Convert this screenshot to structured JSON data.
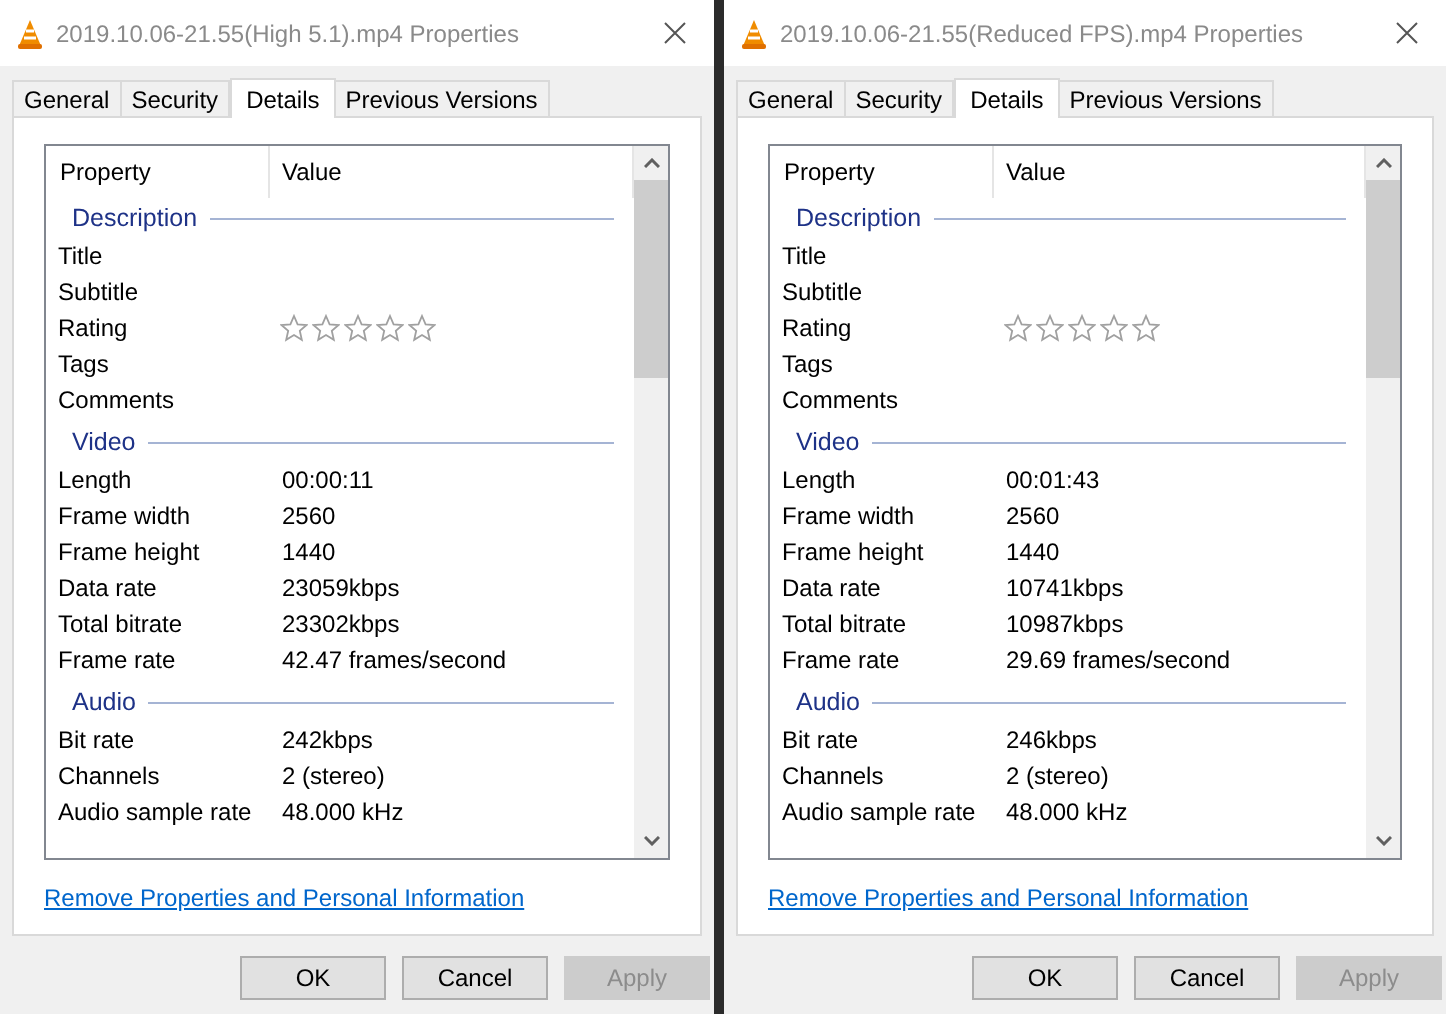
{
  "dialogs": [
    {
      "title": "2019.10.06-21.55(High 5.1).mp4 Properties",
      "active": false,
      "tabs": [
        {
          "label": "General",
          "selected": false
        },
        {
          "label": "Security",
          "selected": false
        },
        {
          "label": "Details",
          "selected": true
        },
        {
          "label": "Previous Versions",
          "selected": false
        }
      ],
      "columns": [
        "Property",
        "Value"
      ],
      "rows": [
        {
          "kind": "section",
          "label": "Description"
        },
        {
          "kind": "property",
          "label": "Title"
        },
        {
          "kind": "property",
          "label": "Subtitle"
        },
        {
          "kind": "rating",
          "label": "Rating",
          "stars": 0
        },
        {
          "kind": "property",
          "label": "Tags"
        },
        {
          "kind": "property",
          "label": "Comments"
        },
        {
          "kind": "section",
          "label": "Video"
        },
        {
          "kind": "property",
          "label": "Length",
          "value": "00:00:11"
        },
        {
          "kind": "property",
          "label": "Frame width",
          "value": "2560"
        },
        {
          "kind": "property",
          "label": "Frame height",
          "value": "1440"
        },
        {
          "kind": "property",
          "label": "Data rate",
          "value": "23059kbps"
        },
        {
          "kind": "property",
          "label": "Total bitrate",
          "value": "23302kbps"
        },
        {
          "kind": "property",
          "label": "Frame rate",
          "value": "42.47 frames/second"
        },
        {
          "kind": "section",
          "label": "Audio"
        },
        {
          "kind": "property",
          "label": "Bit rate",
          "value": "242kbps"
        },
        {
          "kind": "property",
          "label": "Channels",
          "value": "2 (stereo)"
        },
        {
          "kind": "property",
          "label": "Audio sample rate",
          "value": "48.000 kHz"
        }
      ],
      "link": "Remove Properties and Personal Information",
      "buttons": [
        {
          "label": "OK",
          "disabled": false
        },
        {
          "label": "Cancel",
          "disabled": false
        },
        {
          "label": "Apply",
          "disabled": true
        }
      ]
    },
    {
      "title": "2019.10.06-21.55(Reduced FPS).mp4 Properties",
      "active": false,
      "tabs": [
        {
          "label": "General",
          "selected": false
        },
        {
          "label": "Security",
          "selected": false
        },
        {
          "label": "Details",
          "selected": true
        },
        {
          "label": "Previous Versions",
          "selected": false
        }
      ],
      "columns": [
        "Property",
        "Value"
      ],
      "rows": [
        {
          "kind": "section",
          "label": "Description"
        },
        {
          "kind": "property",
          "label": "Title"
        },
        {
          "kind": "property",
          "label": "Subtitle"
        },
        {
          "kind": "rating",
          "label": "Rating",
          "stars": 0
        },
        {
          "kind": "property",
          "label": "Tags"
        },
        {
          "kind": "property",
          "label": "Comments"
        },
        {
          "kind": "section",
          "label": "Video"
        },
        {
          "kind": "property",
          "label": "Length",
          "value": "00:01:43"
        },
        {
          "kind": "property",
          "label": "Frame width",
          "value": "2560"
        },
        {
          "kind": "property",
          "label": "Frame height",
          "value": "1440"
        },
        {
          "kind": "property",
          "label": "Data rate",
          "value": "10741kbps"
        },
        {
          "kind": "property",
          "label": "Total bitrate",
          "value": "10987kbps"
        },
        {
          "kind": "property",
          "label": "Frame rate",
          "value": "29.69 frames/second"
        },
        {
          "kind": "section",
          "label": "Audio"
        },
        {
          "kind": "property",
          "label": "Bit rate",
          "value": "246kbps"
        },
        {
          "kind": "property",
          "label": "Channels",
          "value": "2 (stereo)"
        },
        {
          "kind": "property",
          "label": "Audio sample rate",
          "value": "48.000 kHz"
        }
      ],
      "link": "Remove Properties and Personal Information",
      "buttons": [
        {
          "label": "OK",
          "disabled": false
        },
        {
          "label": "Cancel",
          "disabled": false
        },
        {
          "label": "Apply",
          "disabled": true
        }
      ]
    }
  ]
}
